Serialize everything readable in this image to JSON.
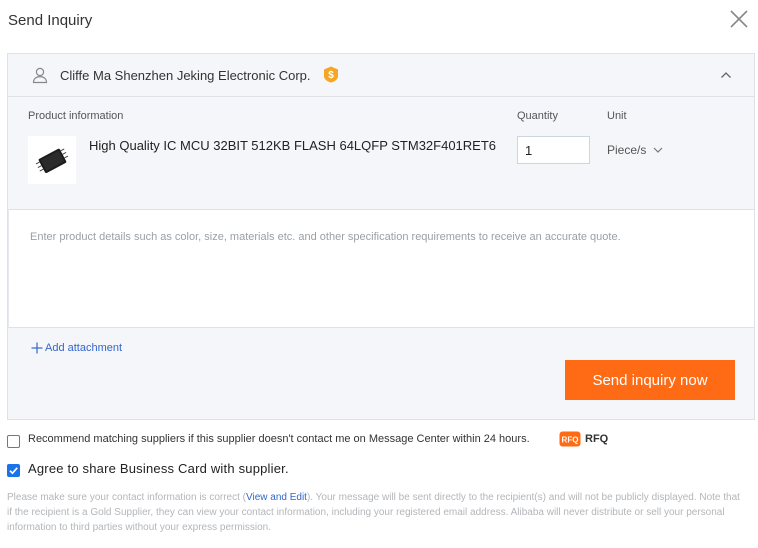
{
  "dialog": {
    "title": "Send Inquiry"
  },
  "supplier": {
    "name": "Cliffe Ma Shenzhen Jeking Electronic Corp.",
    "badge_icon": "gold-supplier-icon",
    "badge_color": "#f5a623"
  },
  "product_table": {
    "header_product": "Product information",
    "header_quantity": "Quantity",
    "header_unit": "Unit",
    "product_name": "High Quality IC MCU 32BIT 512KB FLASH 64LQFP STM32F401RET6",
    "quantity": "1",
    "unit": "Piece/s"
  },
  "message": {
    "placeholder": "Enter product details such as color, size, materials etc. and other specification requirements to receive an accurate quote."
  },
  "attachment": {
    "label": "Add attachment"
  },
  "send_button": {
    "label": "Send inquiry now",
    "color": "#ff6a14"
  },
  "recommend": {
    "label": "Recommend matching suppliers if this supplier doesn't contact me on Message Center within 24 hours.",
    "rfq_label": "RFQ",
    "checked": false
  },
  "agree": {
    "label": "Agree to share Business Card with supplier.",
    "checked": true
  },
  "notice": {
    "before_link": "Please make sure your contact information is correct (",
    "link": "View and Edit",
    "after_link": "). Your message will be sent directly to the recipient(s) and will not be publicly displayed. Note that if the recipient is a Gold Supplier, they can view your contact information, including your registered email address. Alibaba will never distribute or sell your personal information to third parties without your express permission."
  }
}
